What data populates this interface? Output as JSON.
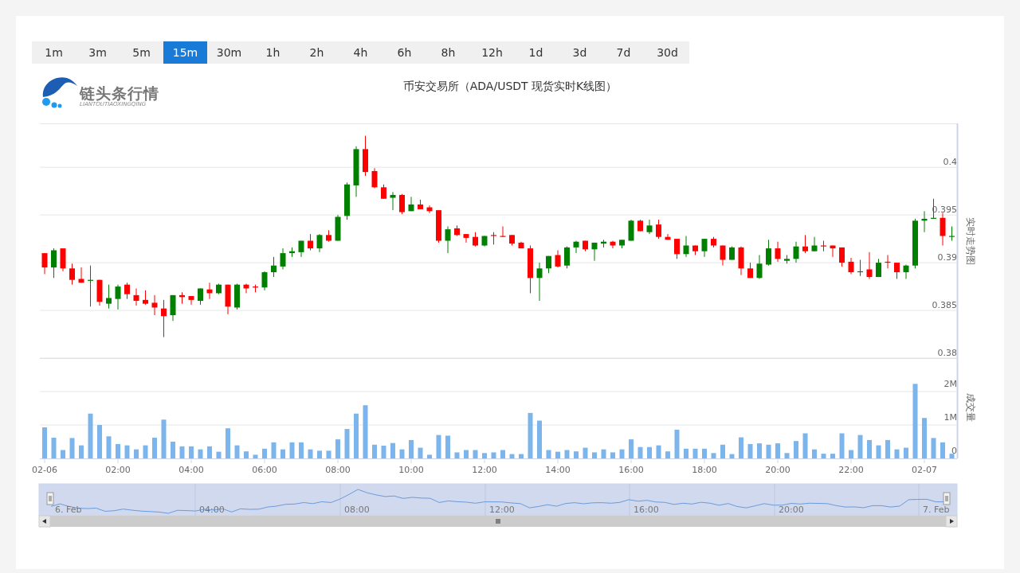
{
  "timeframes": [
    {
      "label": "1m",
      "selected": false
    },
    {
      "label": "3m",
      "selected": false
    },
    {
      "label": "5m",
      "selected": false
    },
    {
      "label": "15m",
      "selected": true
    },
    {
      "label": "30m",
      "selected": false
    },
    {
      "label": "1h",
      "selected": false
    },
    {
      "label": "2h",
      "selected": false
    },
    {
      "label": "4h",
      "selected": false
    },
    {
      "label": "6h",
      "selected": false
    },
    {
      "label": "8h",
      "selected": false
    },
    {
      "label": "12h",
      "selected": false
    },
    {
      "label": "1d",
      "selected": false
    },
    {
      "label": "3d",
      "selected": false
    },
    {
      "label": "7d",
      "selected": false
    },
    {
      "label": "30d",
      "selected": false
    }
  ],
  "logo": {
    "name": "链头条行情",
    "subtitle": "LIANTOUTIAOXINGQING"
  },
  "title": "币安交易所（ADA/USDT 现货实时K线图）",
  "price_chart": {
    "chart_data": {
      "type": "candlestick",
      "ylabel": "实时走势图",
      "ylim": [
        0.38,
        0.4046
      ],
      "yticks": [
        0.4,
        0.395,
        0.39,
        0.385,
        0.38
      ],
      "grid": true,
      "categories": [
        null,
        null,
        null,
        null,
        null,
        null,
        null,
        null,
        null,
        null,
        null,
        null,
        null,
        null,
        null,
        null,
        null,
        null,
        null,
        null,
        null,
        null,
        null,
        null,
        null,
        null,
        null,
        null,
        null,
        null,
        null,
        null,
        null,
        null,
        null,
        null,
        null,
        null,
        null,
        null,
        null,
        null,
        null,
        null,
        null,
        null,
        null,
        null,
        null,
        null,
        null,
        null,
        null,
        null,
        null,
        null,
        null,
        null,
        null,
        null,
        null,
        null,
        null,
        null,
        null,
        null,
        null,
        null,
        null,
        null,
        null,
        null,
        null,
        null,
        null,
        null,
        null,
        null,
        null,
        null,
        null,
        null,
        null,
        null,
        null,
        null,
        null,
        null,
        null,
        null,
        null,
        null,
        null,
        null,
        null,
        null,
        null,
        null,
        null,
        null
      ],
      "ohlc": [
        [
          0.391,
          0.391,
          0.3888,
          0.3895
        ],
        [
          0.3895,
          0.3915,
          0.3884,
          0.3913
        ],
        [
          0.3915,
          0.3915,
          0.3891,
          0.3894
        ],
        [
          0.3894,
          0.3899,
          0.3877,
          0.3882
        ],
        [
          0.3883,
          0.3895,
          0.3879,
          0.3879
        ],
        [
          0.3881,
          0.3897,
          0.3854,
          0.3882
        ],
        [
          0.3882,
          0.3882,
          0.3855,
          0.3859
        ],
        [
          0.3857,
          0.3877,
          0.3852,
          0.3863
        ],
        [
          0.3862,
          0.3877,
          0.3851,
          0.3875
        ],
        [
          0.3877,
          0.3879,
          0.3862,
          0.3867
        ],
        [
          0.3866,
          0.3873,
          0.3855,
          0.386
        ],
        [
          0.3861,
          0.3871,
          0.3856,
          0.3857
        ],
        [
          0.3858,
          0.3866,
          0.3845,
          0.3853
        ],
        [
          0.3852,
          0.3861,
          0.3822,
          0.3844
        ],
        [
          0.3845,
          0.3866,
          0.3839,
          0.3866
        ],
        [
          0.3866,
          0.3869,
          0.3857,
          0.3864
        ],
        [
          0.3865,
          0.3865,
          0.3856,
          0.3861
        ],
        [
          0.386,
          0.3873,
          0.3856,
          0.3873
        ],
        [
          0.3872,
          0.3879,
          0.3862,
          0.3868
        ],
        [
          0.3868,
          0.3878,
          0.3867,
          0.3877
        ],
        [
          0.3877,
          0.3877,
          0.3846,
          0.3854
        ],
        [
          0.3853,
          0.3878,
          0.3851,
          0.3877
        ],
        [
          0.3877,
          0.3878,
          0.3868,
          0.3873
        ],
        [
          0.3875,
          0.3877,
          0.3869,
          0.3874
        ],
        [
          0.3874,
          0.3891,
          0.3871,
          0.389
        ],
        [
          0.389,
          0.3906,
          0.3885,
          0.3897
        ],
        [
          0.3896,
          0.3915,
          0.3893,
          0.391
        ],
        [
          0.391,
          0.3916,
          0.3906,
          0.3912
        ],
        [
          0.3911,
          0.3923,
          0.3906,
          0.3923
        ],
        [
          0.3923,
          0.393,
          0.3913,
          0.3915
        ],
        [
          0.3915,
          0.393,
          0.3911,
          0.3929
        ],
        [
          0.3929,
          0.3934,
          0.3922,
          0.3923
        ],
        [
          0.3923,
          0.395,
          0.3923,
          0.3948
        ],
        [
          0.3949,
          0.3984,
          0.3945,
          0.3982
        ],
        [
          0.3981,
          0.4022,
          0.3969,
          0.4019
        ],
        [
          0.4019,
          0.4033,
          0.3991,
          0.3995
        ],
        [
          0.3996,
          0.3999,
          0.3978,
          0.3979
        ],
        [
          0.3979,
          0.3982,
          0.3967,
          0.3967
        ],
        [
          0.3968,
          0.3974,
          0.3955,
          0.3971
        ],
        [
          0.3971,
          0.3972,
          0.3951,
          0.3953
        ],
        [
          0.3954,
          0.3969,
          0.3954,
          0.3961
        ],
        [
          0.3961,
          0.3966,
          0.3956,
          0.3956
        ],
        [
          0.3958,
          0.396,
          0.3952,
          0.3954
        ],
        [
          0.3955,
          0.3955,
          0.3921,
          0.3923
        ],
        [
          0.3923,
          0.3938,
          0.391,
          0.3935
        ],
        [
          0.3936,
          0.3939,
          0.3928,
          0.3929
        ],
        [
          0.393,
          0.393,
          0.3921,
          0.3926
        ],
        [
          0.3927,
          0.3932,
          0.3917,
          0.3918
        ],
        [
          0.3918,
          0.3928,
          0.3917,
          0.3928
        ],
        [
          0.3929,
          0.3932,
          0.3919,
          0.3928
        ],
        [
          0.3928,
          0.3938,
          0.3927,
          0.3927
        ],
        [
          0.3929,
          0.3929,
          0.3918,
          0.392
        ],
        [
          0.3921,
          0.3922,
          0.3915,
          0.3915
        ],
        [
          0.3915,
          0.3918,
          0.3868,
          0.3884
        ],
        [
          0.3884,
          0.39,
          0.386,
          0.3894
        ],
        [
          0.3894,
          0.3907,
          0.3889,
          0.3907
        ],
        [
          0.3908,
          0.3913,
          0.3895,
          0.3896
        ],
        [
          0.3897,
          0.3917,
          0.3894,
          0.3916
        ],
        [
          0.3916,
          0.3923,
          0.391,
          0.3922
        ],
        [
          0.3923,
          0.3923,
          0.3912,
          0.3914
        ],
        [
          0.3914,
          0.3921,
          0.3902,
          0.3921
        ],
        [
          0.392,
          0.3924,
          0.3916,
          0.3922
        ],
        [
          0.3922,
          0.3923,
          0.3915,
          0.3918
        ],
        [
          0.3918,
          0.3924,
          0.3915,
          0.3924
        ],
        [
          0.3923,
          0.3945,
          0.3923,
          0.3944
        ],
        [
          0.3944,
          0.3945,
          0.3933,
          0.3933
        ],
        [
          0.3932,
          0.3945,
          0.393,
          0.3939
        ],
        [
          0.394,
          0.3945,
          0.3925,
          0.3927
        ],
        [
          0.3927,
          0.393,
          0.3924,
          0.3924
        ],
        [
          0.3925,
          0.3925,
          0.3904,
          0.3909
        ],
        [
          0.3909,
          0.3928,
          0.3906,
          0.3918
        ],
        [
          0.3918,
          0.3918,
          0.3908,
          0.3912
        ],
        [
          0.3912,
          0.3925,
          0.3906,
          0.3925
        ],
        [
          0.3925,
          0.3927,
          0.3916,
          0.3918
        ],
        [
          0.3918,
          0.3918,
          0.3897,
          0.3903
        ],
        [
          0.3903,
          0.3917,
          0.3903,
          0.3916
        ],
        [
          0.3916,
          0.3917,
          0.3887,
          0.3894
        ],
        [
          0.3894,
          0.39,
          0.3884,
          0.3884
        ],
        [
          0.3884,
          0.3908,
          0.3883,
          0.3899
        ],
        [
          0.3898,
          0.3924,
          0.3897,
          0.3915
        ],
        [
          0.3915,
          0.3922,
          0.3901,
          0.3904
        ],
        [
          0.3902,
          0.3908,
          0.3899,
          0.3904
        ],
        [
          0.3904,
          0.3922,
          0.39,
          0.3917
        ],
        [
          0.3917,
          0.3929,
          0.391,
          0.3912
        ],
        [
          0.3912,
          0.3927,
          0.3912,
          0.3918
        ],
        [
          0.3918,
          0.3923,
          0.3912,
          0.3917
        ],
        [
          0.3918,
          0.3918,
          0.3906,
          0.3915
        ],
        [
          0.3916,
          0.3916,
          0.3896,
          0.39
        ],
        [
          0.3901,
          0.3905,
          0.3888,
          0.389
        ],
        [
          0.389,
          0.3903,
          0.3886,
          0.3891
        ],
        [
          0.3893,
          0.3911,
          0.3883,
          0.3885
        ],
        [
          0.3885,
          0.3904,
          0.3885,
          0.39
        ],
        [
          0.3901,
          0.3908,
          0.3894,
          0.39
        ],
        [
          0.39,
          0.39,
          0.3883,
          0.389
        ],
        [
          0.389,
          0.3898,
          0.3883,
          0.3897
        ],
        [
          0.3897,
          0.3946,
          0.3894,
          0.3944
        ],
        [
          0.3944,
          0.3954,
          0.3932,
          0.3946
        ],
        [
          0.3946,
          0.3967,
          0.3946,
          0.3947
        ],
        [
          0.3947,
          0.3952,
          0.3918,
          0.3928
        ],
        [
          0.3927,
          0.3938,
          0.3923,
          0.3928
        ]
      ]
    }
  },
  "volume_chart": {
    "chart_data": {
      "type": "bar",
      "ylabel": "成交量",
      "grid": true,
      "ylim": [
        0,
        3
      ],
      "yticks": [
        {
          "value": 0,
          "label": "0"
        },
        {
          "value": 1,
          "label": "1M"
        },
        {
          "value": 2,
          "label": "2M"
        }
      ],
      "categories": [
        "02-06",
        null,
        null,
        null,
        null,
        null,
        null,
        null,
        "02:00",
        null,
        null,
        null,
        null,
        null,
        null,
        null,
        "04:00",
        null,
        null,
        null,
        null,
        null,
        null,
        null,
        "06:00",
        null,
        null,
        null,
        null,
        null,
        null,
        null,
        "08:00",
        null,
        null,
        null,
        null,
        null,
        null,
        null,
        "10:00",
        null,
        null,
        null,
        null,
        null,
        null,
        null,
        "12:00",
        null,
        null,
        null,
        null,
        null,
        null,
        null,
        "14:00",
        null,
        null,
        null,
        null,
        null,
        null,
        null,
        "16:00",
        null,
        null,
        null,
        null,
        null,
        null,
        null,
        "18:00",
        null,
        null,
        null,
        null,
        null,
        null,
        null,
        "20:00",
        null,
        null,
        null,
        null,
        null,
        null,
        null,
        "22:00",
        null,
        null,
        null,
        null,
        null,
        null,
        null,
        "02-07",
        null,
        null,
        null
      ],
      "values": [
        0.93,
        0.62,
        0.25,
        0.61,
        0.39,
        1.34,
        1.0,
        0.66,
        0.43,
        0.39,
        0.27,
        0.39,
        0.62,
        1.16,
        0.5,
        0.36,
        0.36,
        0.27,
        0.36,
        0.2,
        0.9,
        0.39,
        0.21,
        0.11,
        0.29,
        0.48,
        0.27,
        0.48,
        0.48,
        0.27,
        0.23,
        0.23,
        0.57,
        0.88,
        1.34,
        1.59,
        0.41,
        0.38,
        0.46,
        0.27,
        0.55,
        0.32,
        0.11,
        0.7,
        0.68,
        0.18,
        0.25,
        0.25,
        0.16,
        0.18,
        0.25,
        0.13,
        0.13,
        1.36,
        1.13,
        0.25,
        0.2,
        0.25,
        0.21,
        0.32,
        0.18,
        0.27,
        0.18,
        0.27,
        0.57,
        0.34,
        0.34,
        0.39,
        0.21,
        0.86,
        0.29,
        0.29,
        0.29,
        0.16,
        0.41,
        0.13,
        0.63,
        0.43,
        0.45,
        0.41,
        0.45,
        0.16,
        0.52,
        0.75,
        0.27,
        0.14,
        0.14,
        0.75,
        0.25,
        0.7,
        0.55,
        0.39,
        0.55,
        0.27,
        0.32,
        2.23,
        1.21,
        0.61,
        0.48,
        0.14
      ]
    }
  },
  "navigator": {
    "labels": [
      "6. Feb",
      "04:00",
      "08:00",
      "12:00",
      "16:00",
      "20:00",
      "7. Feb"
    ]
  }
}
